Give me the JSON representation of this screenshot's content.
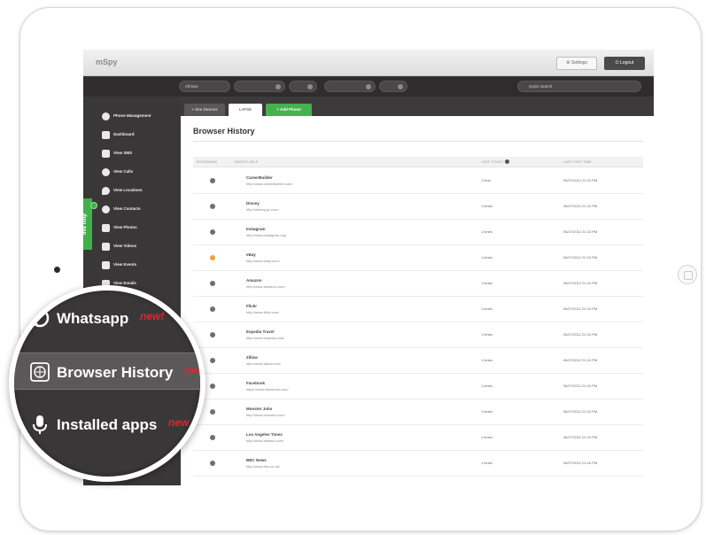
{
  "app": {
    "logo": "mSpy",
    "settings_label": "⚙ Settings",
    "logout_label": "⏻ Logout"
  },
  "filters": {
    "period": "All time",
    "search_placeholder": "Quick search"
  },
  "sidebar": {
    "items": [
      {
        "label": "Phone Management"
      },
      {
        "label": "Dashboard"
      },
      {
        "label": "View SMS"
      },
      {
        "label": "View Calls"
      },
      {
        "label": "View Locations"
      },
      {
        "label": "View Contacts"
      },
      {
        "label": "View Photos"
      },
      {
        "label": "View Videos"
      },
      {
        "label": "View Events"
      },
      {
        "label": "View Emails"
      }
    ],
    "live_help": "live help"
  },
  "tabs": {
    "back": "« See Devices",
    "active": "LAPSE",
    "add": "+ Add Phone"
  },
  "page_title": "Browser History",
  "table": {
    "headers": {
      "bookmark": "BOOKMARK",
      "visited_url": "VISITED URLS",
      "visit_count": "VISIT COUNT",
      "last_visit": "LAST VISIT TIME"
    },
    "rows": [
      {
        "name": "CareerBuilder",
        "url": "http://www.careerbuilder.com/",
        "count": "1 time",
        "date": "06/27/2012 21:10 PM",
        "starred": false
      },
      {
        "name": "Disney",
        "url": "http://disney.go.com/",
        "count": "1 times",
        "date": "06/27/2012 21:10 PM",
        "starred": false
      },
      {
        "name": "Instagram",
        "url": "http://www.instagram.org/",
        "count": "1 times",
        "date": "06/27/2012 21:10 PM",
        "starred": false
      },
      {
        "name": "eBay",
        "url": "http://www.ebay.com/",
        "count": "1 times",
        "date": "06/27/2012 21:10 PM",
        "starred": true
      },
      {
        "name": "Amazon",
        "url": "http://www.amazon.com/",
        "count": "1 times",
        "date": "06/27/2012 21:10 PM",
        "starred": false
      },
      {
        "name": "Flickr",
        "url": "http://www.flickr.com/",
        "count": "1 times",
        "date": "06/27/2012 21:10 PM",
        "starred": false
      },
      {
        "name": "Expedia Travel",
        "url": "http://www.expedia.com/",
        "count": "1 times",
        "date": "06/27/2012 21:10 PM",
        "starred": false
      },
      {
        "name": "Zillow",
        "url": "http://www.zillow.com/",
        "count": "1 times",
        "date": "06/27/2012 21:10 PM",
        "starred": false
      },
      {
        "name": "Facebook",
        "url": "https://www.facebook.com/",
        "count": "1 times",
        "date": "06/27/2012 21:10 PM",
        "starred": false
      },
      {
        "name": "Monster Jobs",
        "url": "http://www.monster.com/",
        "count": "1 times",
        "date": "06/27/2012 21:10 PM",
        "starred": false
      },
      {
        "name": "Los Angeles Times",
        "url": "http://www.latimes.com/",
        "count": "1 times",
        "date": "06/27/2012 21:10 PM",
        "starred": false
      },
      {
        "name": "BBC News",
        "url": "http://www.bbc.co.uk/",
        "count": "1 times",
        "date": "06/27/2012 21:10 PM",
        "starred": false
      }
    ]
  },
  "magnifier": {
    "items": [
      {
        "label": "Whatsapp",
        "badge": "new!",
        "icon": "whatsapp-icon"
      },
      {
        "label": "Browser History",
        "badge": "new",
        "icon": "globe-icon"
      },
      {
        "label": "Installed apps",
        "badge": "new",
        "icon": "apps-icon"
      }
    ]
  },
  "colors": {
    "accent_green": "#47b14f",
    "new_badge_red": "#e0252e",
    "sidebar_bg": "#3a3738"
  }
}
